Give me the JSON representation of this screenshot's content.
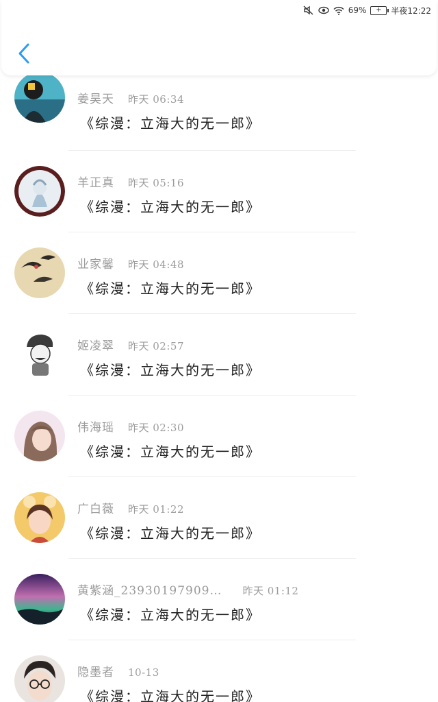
{
  "status_bar": {
    "battery": "69%",
    "time": "半夜12:22",
    "icons": [
      "mute-icon",
      "eye-icon",
      "wifi-icon",
      "battery-icon"
    ]
  },
  "header": {
    "back_icon": "chevron-left-icon",
    "accent": "#2a9cf5"
  },
  "items": [
    {
      "name": "姜昊天",
      "time": "昨天 06:34",
      "title": "《综漫：立海大的无一郎》"
    },
    {
      "name": "羊正真",
      "time": "昨天 05:16",
      "title": "《综漫：立海大的无一郎》"
    },
    {
      "name": "业家馨",
      "time": "昨天 04:48",
      "title": "《综漫：立海大的无一郎》"
    },
    {
      "name": "姬凌翠",
      "time": "昨天 02:57",
      "title": "《综漫：立海大的无一郎》"
    },
    {
      "name": "伟海瑶",
      "time": "昨天 02:30",
      "title": "《综漫：立海大的无一郎》"
    },
    {
      "name": "广白薇",
      "time": "昨天 01:22",
      "title": "《综漫：立海大的无一郎》"
    },
    {
      "name": "黄紫涵_23930197909…",
      "time": "昨天 01:12",
      "title": "《综漫：立海大的无一郎》"
    },
    {
      "name": "隐墨者",
      "time": "10-13",
      "title": "《综漫：立海大的无一郎》"
    }
  ]
}
